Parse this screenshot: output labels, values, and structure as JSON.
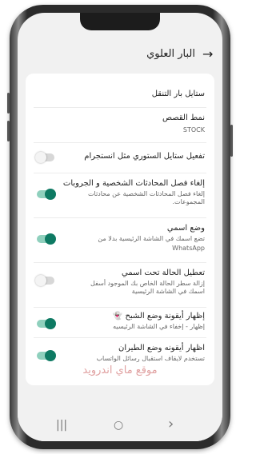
{
  "header": {
    "title": "البار العلوي",
    "back_icon": "arrow-back-icon"
  },
  "items": [
    {
      "title": "ستايل بار التنقل",
      "subtitle": ""
    },
    {
      "title": "نمط القصص",
      "subtitle": "STOCK"
    },
    {
      "title": "تفعيل ستايل الستوري مثل انستجرام",
      "subtitle": "",
      "toggle": "off"
    },
    {
      "title": "إلغاء فصل المحادثات الشخصية و الجروبات",
      "subtitle": "إلغاء فصل المحادثات الشخصية عن محادثات المجموعات.",
      "toggle": "on"
    },
    {
      "title": "وضع اسمي",
      "subtitle": "تضع اسمك في الشاشة الرئيسية بدلا من",
      "subtitle2": "WhatsApp",
      "toggle": "on"
    },
    {
      "title": "تعطيل الحالة تحت اسمي",
      "subtitle": "إزالة سطر الحالة الخاص بك الموجود أسفل اسمك في الشاشة الرئيسية",
      "toggle": "off"
    },
    {
      "title": "إظهار أيقونة وضع الشبح 👻",
      "subtitle": "إظهار - إخفاء في الشاشة الرئيسيه",
      "toggle": "on"
    },
    {
      "title": "اظهار أيقونه وضع الطيران",
      "subtitle": "تستخدم لايقاف استقبال رسائل الواتساب",
      "toggle": "on"
    }
  ],
  "watermark": "موقع ماي اندرويد",
  "nav": {
    "recent": "|||",
    "home": "○",
    "back": "›"
  },
  "colors": {
    "accent": "#0e7a63",
    "track_on": "#8fd0bd"
  }
}
